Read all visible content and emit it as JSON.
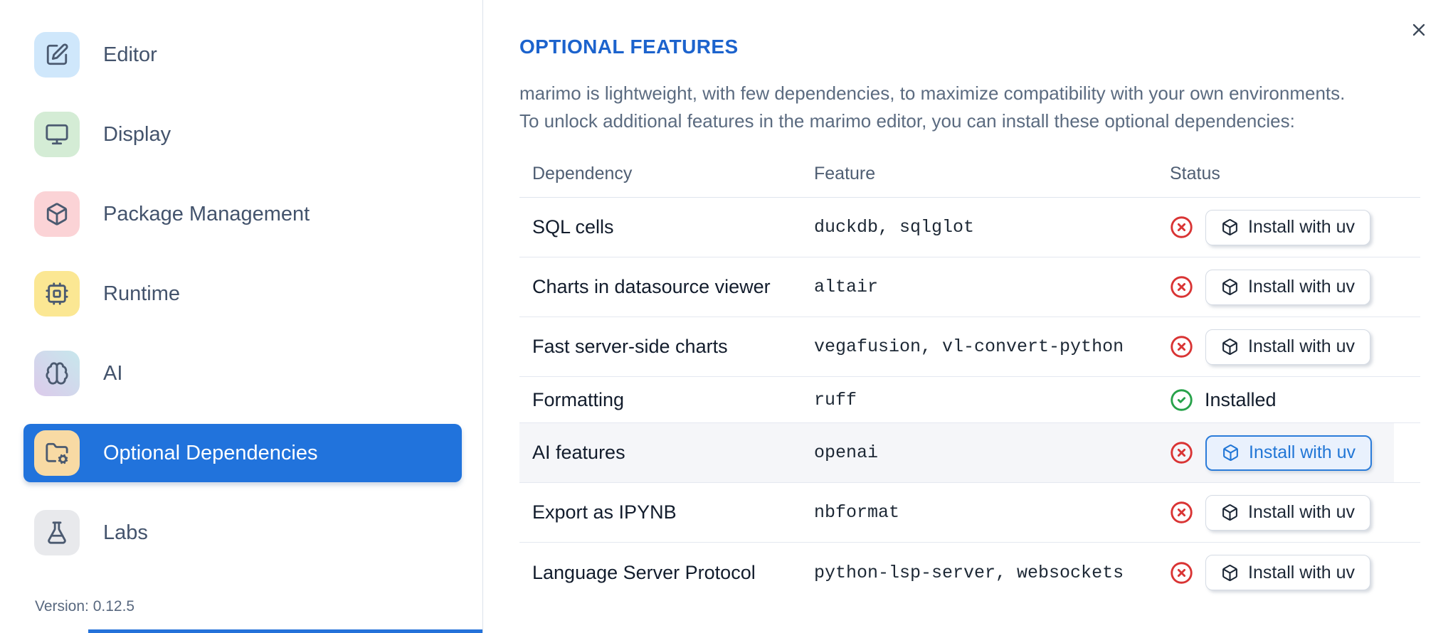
{
  "sidebar": {
    "items": [
      {
        "label": "Editor",
        "icon": "square-pen-icon",
        "tile_color": "#cfe7fb",
        "selected": false
      },
      {
        "label": "Display",
        "icon": "monitor-icon",
        "tile_color": "#d4ecd5",
        "selected": false
      },
      {
        "label": "Package Management",
        "icon": "package-icon",
        "tile_color": "#fbd3d6",
        "selected": false
      },
      {
        "label": "Runtime",
        "icon": "cpu-icon",
        "tile_color": "#fbe793",
        "selected": false
      },
      {
        "label": "AI",
        "icon": "brain-icon",
        "tile_color": "linear-gradient(to bottom left, #c7e7ec, #dccaeb)",
        "selected": false
      },
      {
        "label": "Optional Dependencies",
        "icon": "folder-cog-icon",
        "tile_color": "#f8daa4",
        "selected": true
      },
      {
        "label": "Labs",
        "icon": "flask-icon",
        "tile_color": "#e8e9ec",
        "selected": false
      }
    ],
    "version_label": "Version: 0.12.5"
  },
  "main": {
    "title": "OPTIONAL FEATURES",
    "description_line1": "marimo is lightweight, with few dependencies, to maximize compatibility with your own environments.",
    "description_line2": "To unlock additional features in the marimo editor, you can install these optional dependencies:",
    "close_icon": "x-icon",
    "table": {
      "columns": [
        "Dependency",
        "Feature",
        "Status"
      ],
      "install_button_label": "Install with uv",
      "installed_label": "Installed",
      "rows": [
        {
          "dependency": "SQL cells",
          "feature": "duckdb, sqlglot",
          "status": "not-installed",
          "highlighted": false
        },
        {
          "dependency": "Charts in datasource viewer",
          "feature": "altair",
          "status": "not-installed",
          "highlighted": false
        },
        {
          "dependency": "Fast server-side charts",
          "feature": "vegafusion, vl-convert-python",
          "status": "not-installed",
          "highlighted": false
        },
        {
          "dependency": "Formatting",
          "feature": "ruff",
          "status": "installed",
          "highlighted": false
        },
        {
          "dependency": "AI features",
          "feature": "openai",
          "status": "not-installed",
          "highlighted": true
        },
        {
          "dependency": "Export as IPYNB",
          "feature": "nbformat",
          "status": "not-installed",
          "highlighted": false
        },
        {
          "dependency": "Language Server Protocol",
          "feature": "python-lsp-server, websockets",
          "status": "not-installed",
          "highlighted": false
        }
      ]
    }
  },
  "colors": {
    "accent_blue": "#2173dc",
    "title_blue": "#1c63cd",
    "error_red": "#d93434",
    "success_green": "#27a24a",
    "row_highlight": "#f5f6f9",
    "border": "#e4e8f0"
  }
}
